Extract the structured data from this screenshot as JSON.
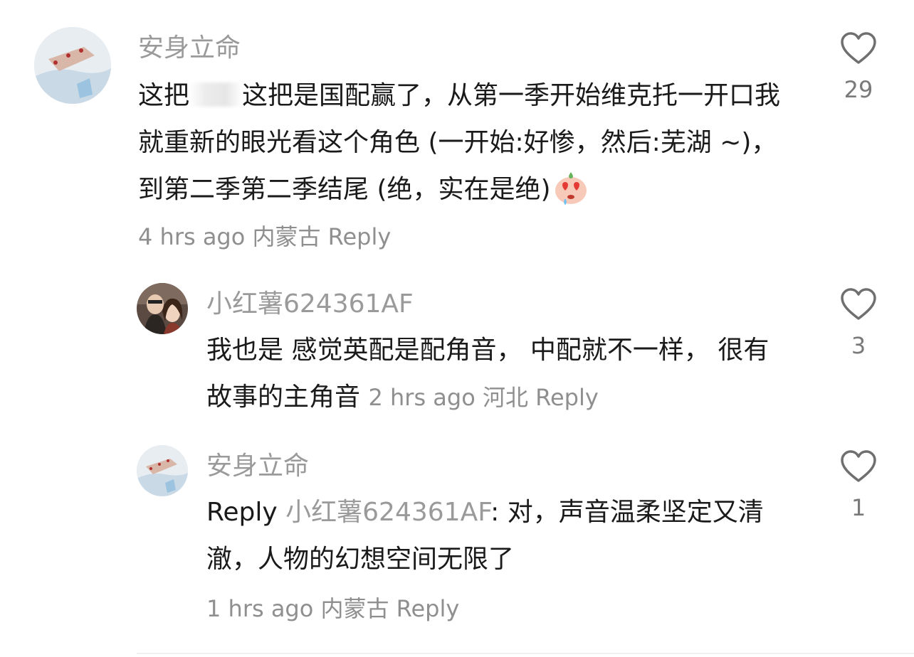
{
  "comments": [
    {
      "username": "安身立命",
      "text_parts": [
        "这把",
        "这把是国配赢了，从第一季开始维克托一开口我就重新的眼光看这个角色 (一开始:好惨，然后:芜湖 ~)，到第二季第二季结尾 (绝，实在是绝)"
      ],
      "time": "4 hrs ago",
      "location": "内蒙古",
      "reply_label": "Reply",
      "likes": "29",
      "emoji_icon": "heart-eyes-face-emoji"
    },
    {
      "username": "小红薯624361AF",
      "text": "我也是 感觉英配是配角音， 中配就不一样， 很有故事的主角音",
      "time": "2 hrs ago",
      "location": "河北",
      "reply_label": "Reply",
      "likes": "3"
    },
    {
      "username": "安身立命",
      "reply_prefix": "Reply",
      "mention": "小红薯624361AF",
      "text": ": 对，声音温柔坚定又清澈，人物的幻想空间无限了",
      "time": "1 hrs ago",
      "location": "内蒙古",
      "reply_label": "Reply",
      "likes": "1"
    }
  ],
  "colors": {
    "text": "#1a1a1a",
    "muted": "#9a9a9a",
    "icon": "#6f6f6f"
  },
  "icons": {
    "like": "heart-outline-icon"
  }
}
